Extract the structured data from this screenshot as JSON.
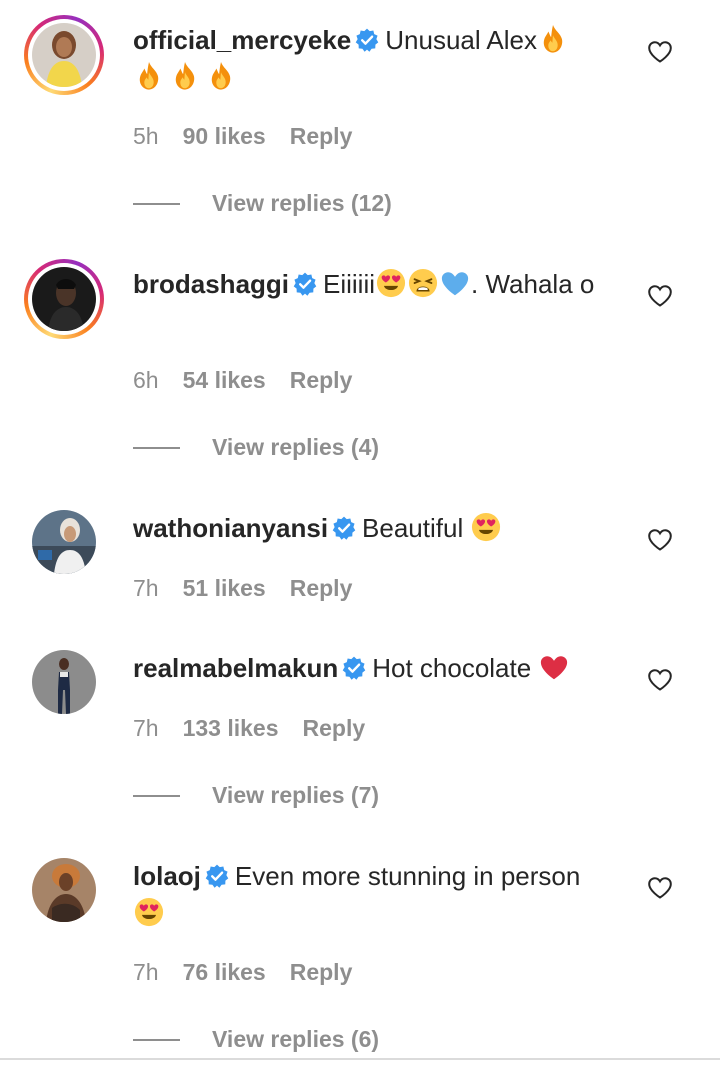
{
  "comments": [
    {
      "username": "official_mercyeke",
      "text": "Unusual Alex",
      "text_rest": "",
      "time": "5h",
      "likes": "90 likes",
      "reply": "Reply",
      "view_replies": "View replies (12)",
      "avatar_story_ring": true
    },
    {
      "username": "brodashaggi",
      "text": "Eiiiiii",
      "text_rest": ". Wahala o",
      "time": "6h",
      "likes": "54 likes",
      "reply": "Reply",
      "view_replies": "View replies (4)",
      "avatar_story_ring": true
    },
    {
      "username": "wathonianyansi",
      "text": "Beautiful",
      "text_rest": "",
      "time": "7h",
      "likes": "51 likes",
      "reply": "Reply",
      "view_replies": "",
      "avatar_story_ring": false
    },
    {
      "username": "realmabelmakun",
      "text": "Hot chocolate",
      "text_rest": "",
      "time": "7h",
      "likes": "133 likes",
      "reply": "Reply",
      "view_replies": "View replies (7)",
      "avatar_story_ring": false
    },
    {
      "username": "lolaoj",
      "text": "Even more stunning in person",
      "text_rest": "",
      "time": "7h",
      "likes": "76 likes",
      "reply": "Reply",
      "view_replies": "View replies (6)",
      "avatar_story_ring": false
    }
  ],
  "icons": {
    "verified": "verified-badge-icon",
    "like": "heart-outline-icon",
    "fire": "fire-emoji",
    "heart_eyes": "heart-eyes-emoji",
    "weary": "weary-face-emoji",
    "blue_heart": "blue-heart-emoji",
    "red_heart": "red-heart-emoji"
  },
  "colors": {
    "text": "#262626",
    "secondary": "#8e8e8e",
    "verified_blue": "#3897f0",
    "divider": "#dbdbdb"
  }
}
